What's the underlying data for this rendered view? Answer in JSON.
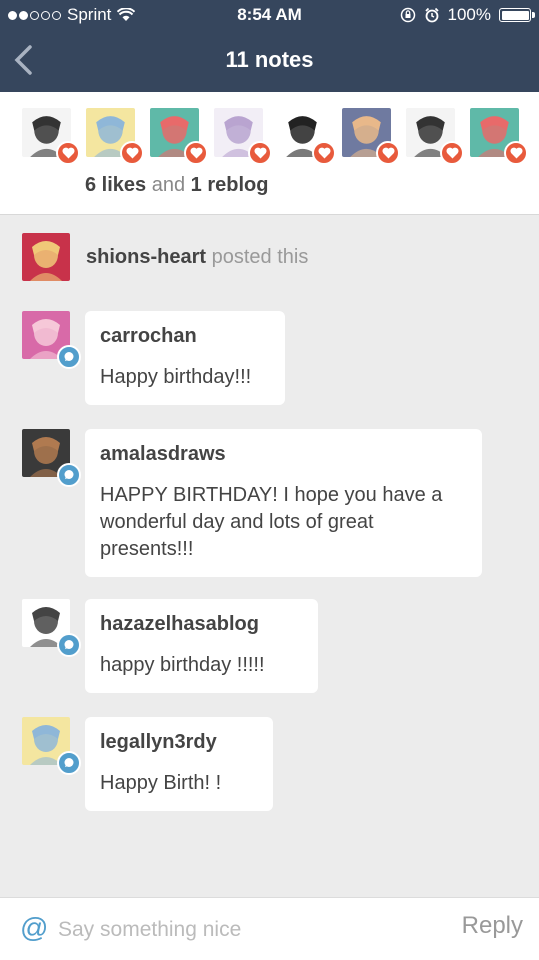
{
  "status_bar": {
    "carrier": "Sprint",
    "time": "8:54 AM",
    "battery": "100%",
    "signal_bars_filled": 2,
    "signal_bars_total": 5
  },
  "nav": {
    "title": "11 notes",
    "back_icon": "chevron-left-icon"
  },
  "likes": {
    "avatars": [
      {
        "user": "like-avatar-1",
        "colors": [
          "#f4f4f4",
          "#333333"
        ]
      },
      {
        "user": "like-avatar-2",
        "colors": [
          "#f4e6a0",
          "#8fb7d8"
        ]
      },
      {
        "user": "like-avatar-3",
        "colors": [
          "#5fb9a8",
          "#e86a6a"
        ]
      },
      {
        "user": "like-avatar-4",
        "colors": [
          "#f2eef6",
          "#b9a4d0"
        ]
      },
      {
        "user": "like-avatar-5",
        "colors": [
          "#ffffff",
          "#222222"
        ]
      },
      {
        "user": "like-avatar-6",
        "colors": [
          "#6f7aa0",
          "#e8b88a"
        ]
      },
      {
        "user": "like-avatar-7",
        "colors": [
          "#f4f4f4",
          "#333333"
        ]
      },
      {
        "user": "like-avatar-8",
        "colors": [
          "#5fb9a8",
          "#e86a6a"
        ]
      }
    ],
    "likes_count": "6 likes",
    "conjunction": "and",
    "reblogs_count": "1 reblog"
  },
  "poster": {
    "username": "shions-heart",
    "action": "posted this",
    "colors": [
      "#c8324a",
      "#f0c878"
    ]
  },
  "replies": [
    {
      "username": "carrochan",
      "message": "Happy birthday!!!",
      "colors": [
        "#d86aa8",
        "#f6c8d8"
      ]
    },
    {
      "username": "amalasdraws",
      "message": "HAPPY BIRTHDAY! I hope you have a wonderful day and lots of great presents!!!",
      "colors": [
        "#3a3a3a",
        "#b07a50"
      ]
    },
    {
      "username": "hazazelhasablog",
      "message": "happy birthday !!!!!",
      "colors": [
        "#ffffff",
        "#444444"
      ]
    },
    {
      "username": "legallyn3rdy",
      "message": "Happy Birth! !",
      "colors": [
        "#f4e6a0",
        "#8fb7d8"
      ]
    }
  ],
  "compose": {
    "at_symbol": "@",
    "placeholder": "Say something nice",
    "reply_label": "Reply"
  },
  "colors": {
    "nav_bg": "#36465d",
    "heart_badge": "#e85a3c",
    "reply_badge": "#529ecc",
    "background": "#ececec"
  }
}
